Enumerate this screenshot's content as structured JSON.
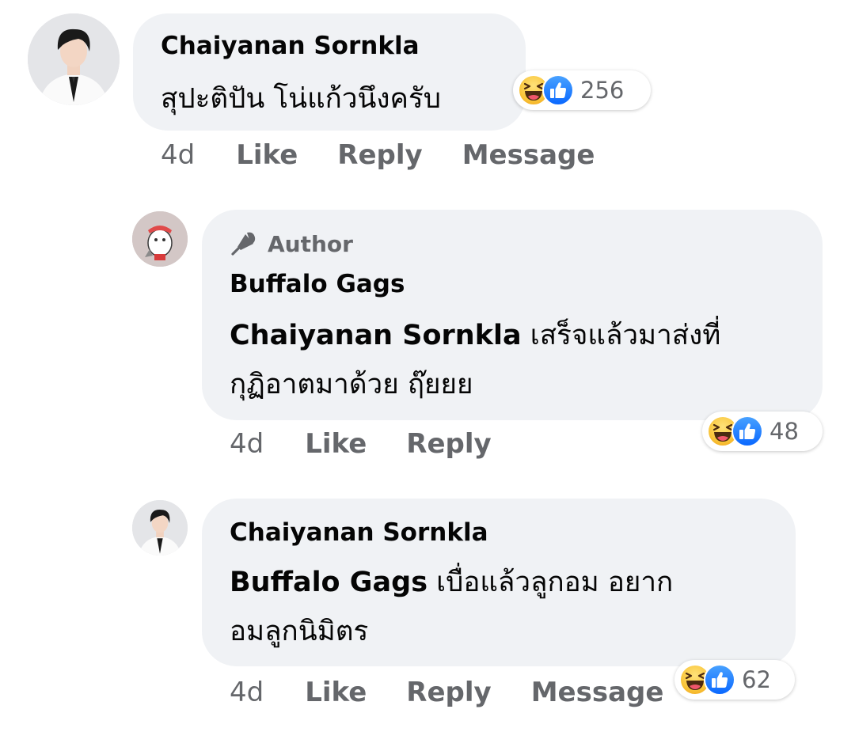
{
  "comments": [
    {
      "author": "Chaiyanan Sornkla",
      "text": "สุปะติปัน โน่แก้วนึงครับ",
      "time": "4d",
      "like": "Like",
      "reply": "Reply",
      "message": "Message",
      "reactions": {
        "icons": [
          "haha-icon",
          "like-icon"
        ],
        "count": "256"
      }
    },
    {
      "badge": "Author",
      "author": "Buffalo Gags",
      "mention": "Chaiyanan Sornkla",
      "text_line1": " เสร็จแล้วมาส่งที่",
      "text_line2": "กุฏิอาตมาด้วย ฤ๊ยยย",
      "time": "4d",
      "like": "Like",
      "reply": "Reply",
      "reactions": {
        "icons": [
          "haha-icon",
          "like-icon"
        ],
        "count": "48"
      }
    },
    {
      "author": "Chaiyanan Sornkla",
      "mention": "Buffalo Gags",
      "text_line1": " เบื่อแล้วลูกอม  อยาก",
      "text_line2": "อมลูกนิมิตร",
      "time": "4d",
      "like": "Like",
      "reply": "Reply",
      "message": "Message",
      "reactions": {
        "icons": [
          "haha-icon",
          "like-icon"
        ],
        "count": "62"
      }
    }
  ],
  "colors": {
    "bubble": "#f0f2f5",
    "meta_text": "#65676b",
    "like_blue": "#1877f2",
    "haha_yellow": "#f7c744"
  }
}
